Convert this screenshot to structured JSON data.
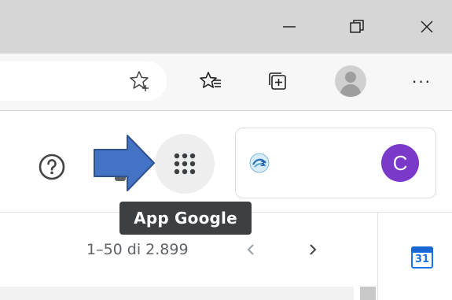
{
  "titlebar": {
    "minimize_icon": "minimize-icon",
    "restore_icon": "restore-icon",
    "close_icon": "close-icon"
  },
  "toolbar": {
    "favorite_icon": "star-add-icon",
    "favorites_list_icon": "favorites-icon",
    "collections_icon": "collections-icon",
    "profile_icon": "profile-avatar",
    "more_icon": "more-dots-icon",
    "more_label": "···"
  },
  "gmail": {
    "help_icon": "help-icon",
    "apps_icon": "apps-grid-icon",
    "tooltip": "App Google",
    "account_initial": "C",
    "account_avatar_color": "#7b39c9",
    "pager": "1–50 di 2.899",
    "prev_icon": "chevron-left-icon",
    "next_icon": "chevron-right-icon",
    "calendar_day": "31"
  },
  "annotation": {
    "arrow_color": "#4472c4"
  }
}
